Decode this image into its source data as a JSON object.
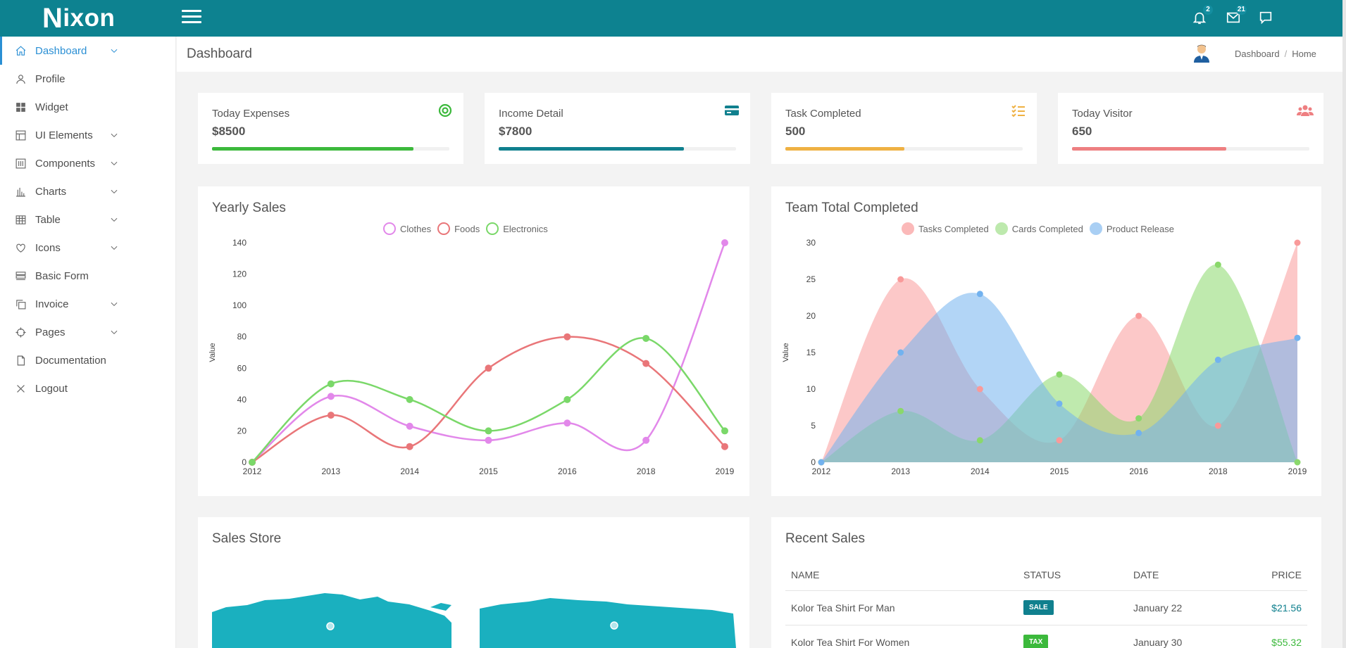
{
  "app": {
    "logo_initial": "N",
    "logo_rest": "ixon",
    "notifications_count": "2",
    "messages_count": "21"
  },
  "sidebar": {
    "items": [
      {
        "label": "Dashboard",
        "icon": "home-icon",
        "active": true,
        "has_submenu": true
      },
      {
        "label": "Profile",
        "icon": "user-icon",
        "has_submenu": false
      },
      {
        "label": "Widget",
        "icon": "widget-icon",
        "has_submenu": false
      },
      {
        "label": "UI Elements",
        "icon": "layout-icon",
        "has_submenu": true
      },
      {
        "label": "Components",
        "icon": "sliders-icon",
        "has_submenu": true
      },
      {
        "label": "Charts",
        "icon": "bar-chart-icon",
        "has_submenu": true
      },
      {
        "label": "Table",
        "icon": "table-icon",
        "has_submenu": true
      },
      {
        "label": "Icons",
        "icon": "heart-icon",
        "has_submenu": true
      },
      {
        "label": "Basic Form",
        "icon": "form-icon",
        "has_submenu": false
      },
      {
        "label": "Invoice",
        "icon": "copy-icon",
        "has_submenu": true
      },
      {
        "label": "Pages",
        "icon": "crosshair-icon",
        "has_submenu": true
      },
      {
        "label": "Documentation",
        "icon": "file-icon",
        "has_submenu": false
      },
      {
        "label": "Logout",
        "icon": "close-icon",
        "has_submenu": false
      }
    ]
  },
  "header": {
    "title": "Dashboard",
    "breadcrumb": [
      "Dashboard",
      "Home"
    ]
  },
  "stats": [
    {
      "label": "Today Expenses",
      "value": "$8500",
      "progress": 0.85,
      "color": "#3cb93c",
      "icon": "target-icon"
    },
    {
      "label": "Income Detail",
      "value": "$7800",
      "progress": 0.78,
      "color": "#10808e",
      "icon": "credit-card-icon"
    },
    {
      "label": "Task Completed",
      "value": "500",
      "progress": 0.5,
      "color": "#efb143",
      "icon": "checklist-icon"
    },
    {
      "label": "Today Visitor",
      "value": "650",
      "progress": 0.65,
      "color": "#ee7f81",
      "icon": "users-icon"
    }
  ],
  "panels": {
    "yearly_sales": "Yearly Sales",
    "team_total": "Team Total Completed",
    "sales_store": "Sales Store",
    "recent_sales": "Recent Sales"
  },
  "chart_data": [
    {
      "type": "line",
      "title": "Yearly Sales",
      "ylabel": "Value",
      "x": [
        "2012",
        "2013",
        "2014",
        "2015",
        "2016",
        "2018",
        "2019"
      ],
      "ylim": [
        0,
        140
      ],
      "yticks": [
        0,
        20,
        40,
        60,
        80,
        100,
        120,
        140
      ],
      "legend": "top",
      "series": [
        {
          "name": "Clothes",
          "color": "#e288ea",
          "values": [
            0,
            42,
            23,
            14,
            25,
            14,
            140
          ]
        },
        {
          "name": "Foods",
          "color": "#e97679",
          "values": [
            0,
            30,
            10,
            60,
            80,
            63,
            10
          ]
        },
        {
          "name": "Electronics",
          "color": "#7ad869",
          "values": [
            0,
            50,
            40,
            20,
            40,
            79,
            20
          ]
        }
      ]
    },
    {
      "type": "area",
      "title": "Team Total Completed",
      "ylabel": "Value",
      "x": [
        "2012",
        "2013",
        "2014",
        "2015",
        "2016",
        "2018",
        "2019"
      ],
      "ylim": [
        0,
        30
      ],
      "yticks": [
        0,
        5,
        10,
        15,
        20,
        25,
        30
      ],
      "legend": "top",
      "series": [
        {
          "name": "Tasks Completed",
          "color": "#f99a9a",
          "values": [
            0,
            25,
            10,
            3,
            20,
            5,
            30
          ]
        },
        {
          "name": "Cards Completed",
          "color": "#8ad86b",
          "values": [
            0,
            7,
            3,
            12,
            6,
            27,
            0
          ]
        },
        {
          "name": "Product Release",
          "color": "#72b2ef",
          "values": [
            0,
            15,
            23,
            8,
            4,
            14,
            17
          ]
        }
      ]
    }
  ],
  "recent_sales": {
    "headers": [
      "NAME",
      "STATUS",
      "DATE",
      "PRICE"
    ],
    "rows": [
      {
        "name": "Kolor Tea Shirt For Man",
        "status": "SALE",
        "status_color": "#10808e",
        "date": "January 22",
        "price": "$21.56",
        "price_color": "#10808e"
      },
      {
        "name": "Kolor Tea Shirt For Women",
        "status": "TAX",
        "status_color": "#3cb93c",
        "date": "January 30",
        "price": "$55.32",
        "price_color": "#3cb93c"
      }
    ]
  }
}
